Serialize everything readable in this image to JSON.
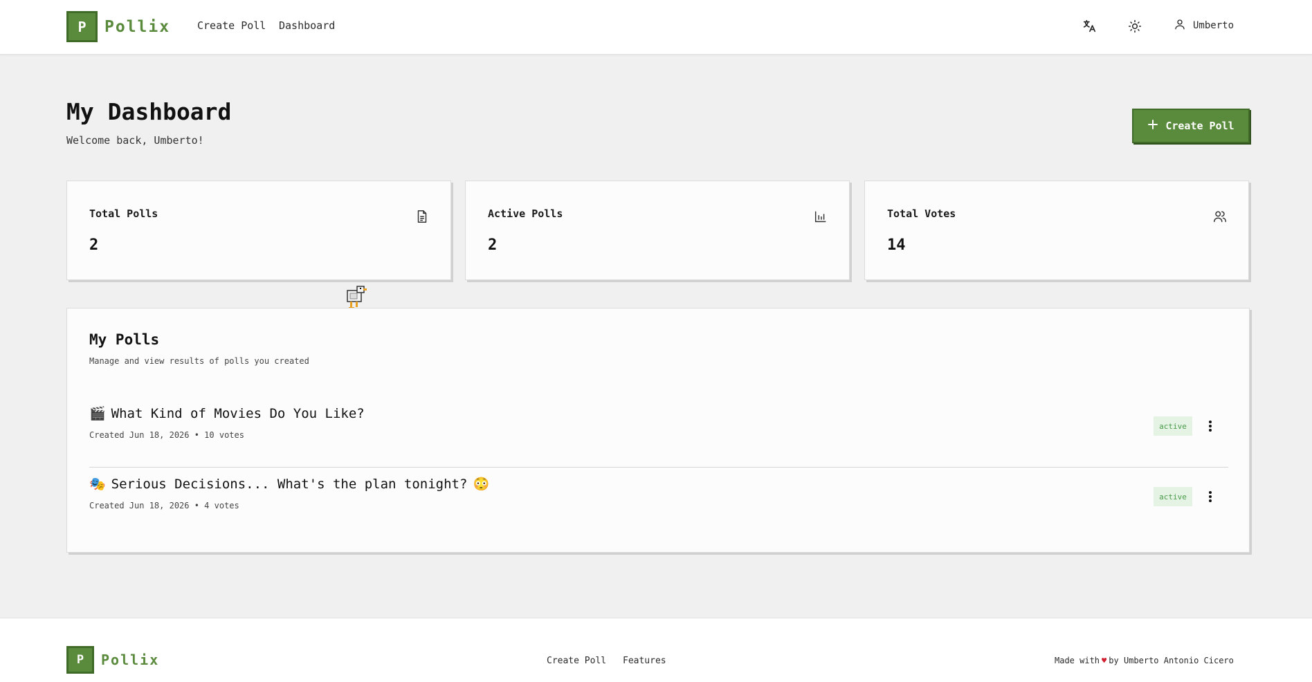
{
  "brand": {
    "logo_letter": "P",
    "name": "Pollix",
    "color": "#5a8a3c"
  },
  "nav": {
    "create_poll": "Create Poll",
    "dashboard": "Dashboard"
  },
  "header": {
    "icons": [
      "translate-icon",
      "sun-icon",
      "user-icon"
    ],
    "username": "Umberto"
  },
  "page": {
    "title": "My Dashboard",
    "subtitle": "Welcome back, Umberto!",
    "create_button": "Create Poll"
  },
  "stats": [
    {
      "label": "Total Polls",
      "value": "2",
      "icon": "document-icon"
    },
    {
      "label": "Active Polls",
      "value": "2",
      "icon": "bar-chart-icon"
    },
    {
      "label": "Total Votes",
      "value": "14",
      "icon": "users-icon"
    }
  ],
  "polls_panel": {
    "title": "My Polls",
    "subtitle": "Manage and view results of polls you created",
    "polls": [
      {
        "emoji": "🎬",
        "title": "What Kind of Movies Do You Like?",
        "trailing_emoji": "",
        "meta": "Created Jun 18, 2026 • 10 votes",
        "status": "active"
      },
      {
        "emoji": "🎭",
        "title": "Serious Decisions... What's the plan tonight?",
        "trailing_emoji": "😳",
        "meta": "Created Jun 18, 2026 • 4 votes",
        "status": "active"
      }
    ]
  },
  "footer": {
    "logo_letter": "P",
    "name": "Pollix",
    "links": [
      "Create Poll",
      "Features"
    ],
    "made_with_prefix": "Made with",
    "heart": "♥",
    "made_with_suffix": "by Umberto Antonio Cicero"
  }
}
